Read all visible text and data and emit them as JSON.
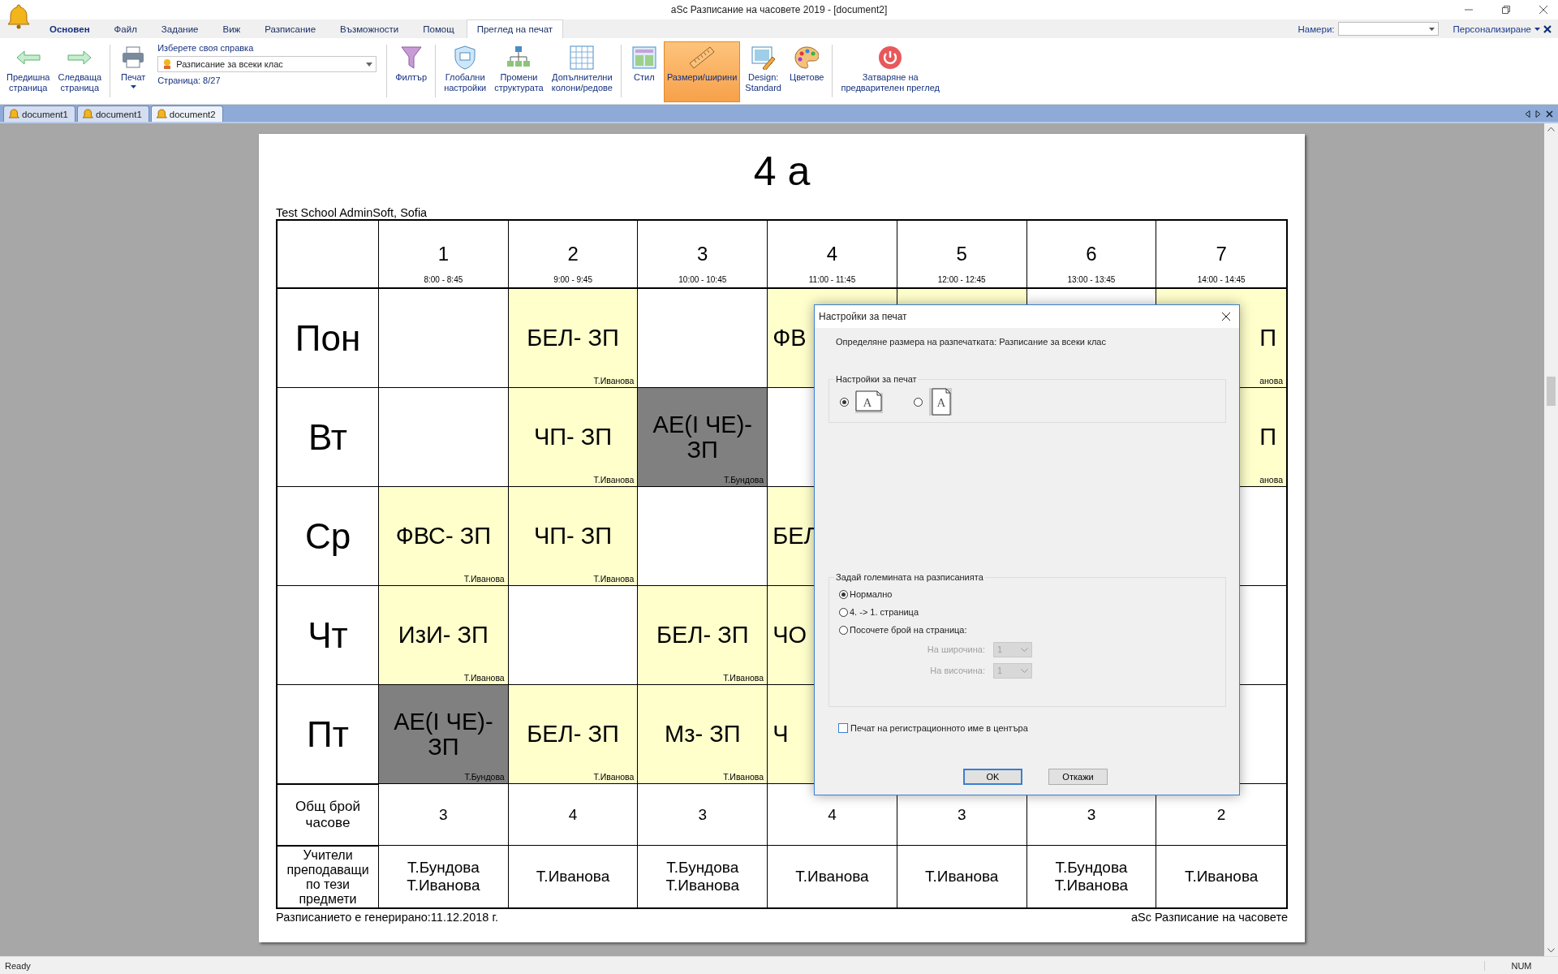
{
  "window": {
    "title": "aSc Разписание на часовете 2019  - [document2]"
  },
  "menu_tabs": [
    {
      "label": "Основен",
      "kind": "app",
      "selected": false
    },
    {
      "label": "Файл",
      "kind": "tab",
      "selected": false
    },
    {
      "label": "Задание",
      "kind": "tab",
      "selected": false
    },
    {
      "label": "Виж",
      "kind": "tab",
      "selected": false
    },
    {
      "label": "Разписание",
      "kind": "tab",
      "selected": false
    },
    {
      "label": "Възможности",
      "kind": "tab",
      "selected": false
    },
    {
      "label": "Помощ",
      "kind": "tab",
      "selected": false
    },
    {
      "label": "Преглед на печат",
      "kind": "tab",
      "selected": true
    }
  ],
  "find": {
    "label": "Намери:"
  },
  "customize": {
    "label": "Персонализиране"
  },
  "ribbon": {
    "groups": [
      [
        {
          "kind": "button",
          "label": "Предишна\nстраница",
          "selected": false
        },
        {
          "kind": "button",
          "label": "Следваща\nстраница",
          "selected": false
        }
      ],
      [
        {
          "kind": "menu-button",
          "label": "Печат",
          "selected": false
        },
        {
          "kind": "report",
          "heading": "Изберете своя справка",
          "value": "Разписание за всеки клас",
          "page": "Страница: 8/27"
        }
      ],
      [
        {
          "kind": "button",
          "label": "Филтър",
          "selected": false
        }
      ],
      [
        {
          "kind": "button",
          "label": "Глобални\nнастройки",
          "selected": false
        },
        {
          "kind": "button",
          "label": "Промени\nструктурата",
          "selected": false
        },
        {
          "kind": "button",
          "label": "Допълнителни\nколони/редове",
          "selected": false
        }
      ],
      [
        {
          "kind": "button",
          "label": "Стил",
          "selected": false
        },
        {
          "kind": "button",
          "label": "Размери/ширини",
          "selected": true
        },
        {
          "kind": "button",
          "label": "Design:\nStandard",
          "selected": false
        },
        {
          "kind": "button",
          "label": "Цветове",
          "selected": false
        }
      ],
      [
        {
          "kind": "button",
          "label": "Затваряне на\nпредварителен преглед",
          "selected": false
        }
      ]
    ]
  },
  "doc_tabs": [
    {
      "label": "document1",
      "selected": false
    },
    {
      "label": "document1",
      "selected": false
    },
    {
      "label": "document2",
      "selected": true
    }
  ],
  "page": {
    "title": "4 а",
    "school": "Test School AdminSoft, Sofia",
    "footer_left": "Разписанието е генерирано:11.12.2018 г.",
    "footer_right": "aSc Разписание на часовете",
    "table": {
      "periods": [
        {
          "number": "1",
          "time": "8:00 - 8:45"
        },
        {
          "number": "2",
          "time": "9:00 - 9:45"
        },
        {
          "number": "3",
          "time": "10:00 - 10:45"
        },
        {
          "number": "4",
          "time": "11:00 - 11:45"
        },
        {
          "number": "5",
          "time": "12:00 - 12:45"
        },
        {
          "number": "6",
          "time": "13:00 - 13:45"
        },
        {
          "number": "7",
          "time": "14:00 - 14:45"
        }
      ],
      "days": [
        {
          "name": "Пон",
          "cells": [
            {
              "color": "#ffffff"
            },
            {
              "subject": "БЕЛ- ЗП",
              "teacher": "Т.Иванова",
              "color": "#ffffcc"
            },
            {
              "color": "#ffffff"
            },
            {
              "subject": "ФВ",
              "color": "#ffffcc"
            },
            {
              "color": "#ffffcc"
            },
            {
              "color": "#ffffff"
            },
            {
              "subject": "П",
              "teacher": "анова",
              "color": "#ffffcc"
            }
          ]
        },
        {
          "name": "Вт",
          "cells": [
            {
              "color": "#ffffff"
            },
            {
              "subject": "ЧП- ЗП",
              "teacher": "Т.Иванова",
              "color": "#ffffcc"
            },
            {
              "subject": "АЕ(I ЧЕ)- ЗП",
              "teacher": "Т.Бундова",
              "color": "#808080"
            },
            {
              "color": "#ffffff"
            },
            {},
            {},
            {
              "subject": "П",
              "teacher": "анова",
              "color": "#ffffcc"
            }
          ]
        },
        {
          "name": "Ср",
          "cells": [
            {
              "subject": "ФВС- ЗП",
              "teacher": "Т.Иванова",
              "color": "#ffffcc"
            },
            {
              "subject": "ЧП- ЗП",
              "teacher": "Т.Иванова",
              "color": "#ffffcc"
            },
            {
              "color": "#ffffff"
            },
            {
              "subject": "БЕЛ",
              "color": "#ffffcc"
            },
            {},
            {},
            {
              "color": "#ffffff"
            }
          ]
        },
        {
          "name": "Чт",
          "cells": [
            {
              "subject": "ИзИ- ЗП",
              "teacher": "Т.Иванова",
              "color": "#ffffcc"
            },
            {
              "color": "#ffffff"
            },
            {
              "subject": "БЕЛ- ЗП",
              "teacher": "Т.Иванова",
              "color": "#ffffcc"
            },
            {
              "subject": "ЧО",
              "color": "#ffffcc"
            },
            {},
            {},
            {
              "color": "#ffffff"
            }
          ]
        },
        {
          "name": "Пт",
          "cells": [
            {
              "subject": "АЕ(I ЧЕ)- ЗП",
              "teacher": "Т.Бундова",
              "color": "#808080"
            },
            {
              "subject": "БЕЛ- ЗП",
              "teacher": "Т.Иванова",
              "color": "#ffffcc"
            },
            {
              "subject": "Мз- ЗП",
              "teacher": "Т.Иванова",
              "color": "#ffffcc"
            },
            {
              "subject": "Ч",
              "color": "#ffffcc"
            },
            {},
            {},
            {
              "color": "#ffffff"
            }
          ]
        }
      ],
      "totals": {
        "label": "Общ брой часове",
        "values": [
          "3",
          "4",
          "3",
          "4",
          "3",
          "3",
          "2"
        ]
      },
      "teachers": {
        "label": "Учители преподаващи по тези предмети",
        "values": [
          "Т.Бундова\nТ.Иванова",
          "Т.Иванова",
          "Т.Бундова\nТ.Иванова",
          "Т.Иванова",
          "Т.Иванова",
          "Т.Бундова\nТ.Иванова",
          "Т.Иванова"
        ]
      }
    }
  },
  "dialog": {
    "title": "Настройки за печат",
    "description": "Определяне размера на разпечатката: Разписание за всеки клас",
    "orientation": {
      "legend": "Настройки за печат",
      "options": [
        {
          "letter": "A",
          "selected": true
        },
        {
          "letter": "A",
          "selected": false
        }
      ]
    },
    "size": {
      "legend": "Задай големината на разписанията",
      "options": [
        {
          "label": "Нормално",
          "selected": true
        },
        {
          "label": "4. -> 1. страница",
          "selected": false
        },
        {
          "label": "Посочете брой на страница:",
          "selected": false
        }
      ],
      "fields": [
        {
          "label": "На широчина:",
          "value": "1",
          "disabled": true
        },
        {
          "label": "На височина:",
          "value": "1",
          "disabled": true
        }
      ]
    },
    "checkbox": {
      "label": "Печат на регистрационното име в центъра",
      "checked": false
    },
    "buttons": [
      "OK",
      "Откажи"
    ]
  },
  "status_bar": {
    "left": "Ready",
    "right": "NUM"
  }
}
